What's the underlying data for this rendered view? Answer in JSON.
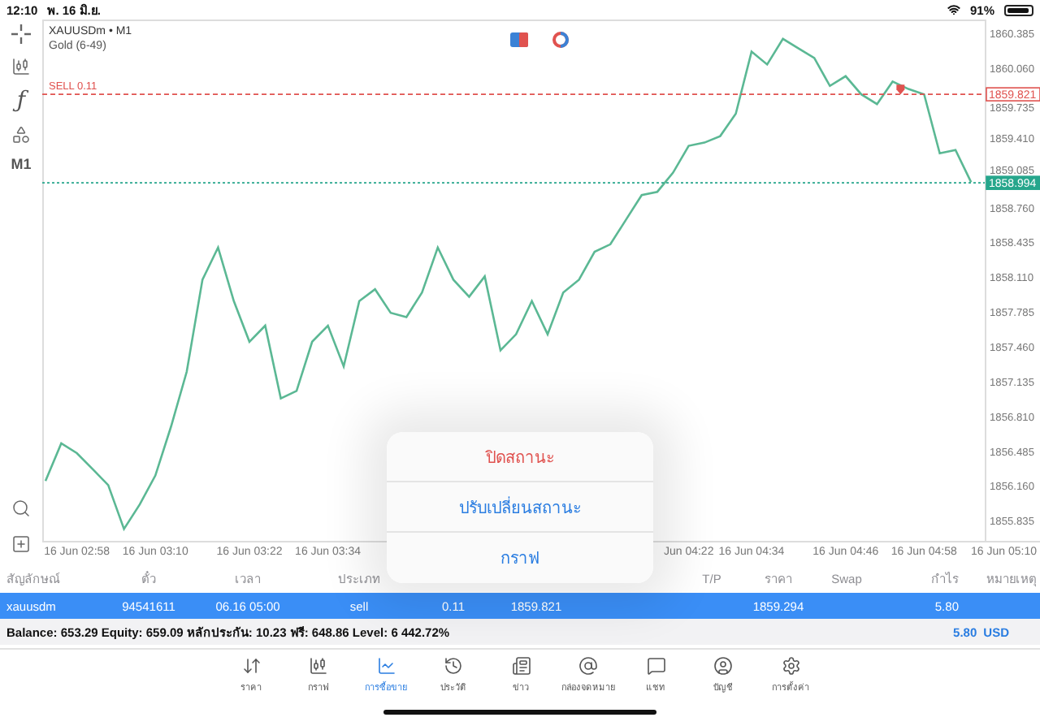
{
  "status_bar": {
    "time": "12:10",
    "date": "พ. 16 มิ.ย.",
    "battery": "91%"
  },
  "chart": {
    "symbol": "XAUUSDm • M1",
    "subtitle": "Gold (6-49)",
    "tools": [
      {
        "kind": "crosshair"
      },
      {
        "kind": "candles"
      },
      {
        "kind": "function",
        "label": "ƒ"
      },
      {
        "kind": "objects"
      },
      {
        "kind": "timeframe",
        "label": "M1"
      },
      {
        "kind": "zoom"
      },
      {
        "kind": "add"
      }
    ],
    "order_label": "SELL 0.11",
    "price_tags": [
      {
        "filled": false
      },
      {
        "filled": true
      }
    ],
    "chart_data": {
      "type": "line",
      "ylim": [
        1855.65,
        1860.52
      ],
      "categories": [
        null,
        null,
        "16 Jun 02:58",
        null,
        null,
        null,
        null,
        "16 Jun 03:10",
        null,
        null,
        null,
        null,
        null,
        "16 Jun 03:22",
        null,
        null,
        null,
        null,
        "16 Jun 03:34",
        null,
        null,
        null,
        null,
        null,
        null,
        null,
        null,
        null,
        null,
        null,
        null,
        null,
        null,
        null,
        null,
        null,
        null,
        null,
        null,
        null,
        null,
        "Jun 04:22",
        null,
        null,
        null,
        "16 Jun 04:34",
        null,
        null,
        null,
        null,
        null,
        "16 Jun 04:46",
        null,
        null,
        null,
        null,
        "16 Jun 04:58",
        null,
        null,
        null,
        null,
        "16 Jun 05:10"
      ],
      "yticks": [
        {
          "value": 1860.385,
          "label": "1860.385"
        },
        {
          "value": 1860.06,
          "label": "1860.060"
        },
        {
          "value": 1859.735,
          "label": "1859.735"
        },
        {
          "value": 1859.41,
          "label": "1859.410"
        },
        {
          "value": 1859.085,
          "label": "1859.085"
        },
        {
          "value": 1858.76,
          "label": "1858.760"
        },
        {
          "value": 1858.435,
          "label": "1858.435"
        },
        {
          "value": 1858.11,
          "label": "1858.110"
        },
        {
          "value": 1857.785,
          "label": "1857.785"
        },
        {
          "value": 1857.46,
          "label": "1857.460"
        },
        {
          "value": 1857.135,
          "label": "1857.135"
        },
        {
          "value": 1856.81,
          "label": "1856.810"
        },
        {
          "value": 1856.485,
          "label": "1856.485"
        },
        {
          "value": 1856.16,
          "label": "1856.160"
        },
        {
          "value": 1855.835,
          "label": "1855.835"
        }
      ],
      "series": [
        {
          "color": "#5bb894",
          "values": [
            1856.21,
            1856.56,
            1856.47,
            1856.32,
            1856.17,
            1855.76,
            1855.99,
            1856.26,
            1856.72,
            1857.23,
            1858.09,
            1858.39,
            1857.89,
            1857.51,
            1857.66,
            1856.98,
            1857.05,
            1857.51,
            1857.66,
            1857.28,
            1857.89,
            1858.0,
            1857.78,
            1857.74,
            1857.97,
            1858.39,
            1858.09,
            1857.93,
            1858.12,
            1857.43,
            1857.58,
            1857.89,
            1857.58,
            1857.97,
            1858.09,
            1858.35,
            1858.42,
            1858.65,
            1858.88,
            1858.91,
            1859.09,
            1859.34,
            1859.37,
            1859.43,
            1859.64,
            1860.22,
            1860.1,
            1860.34,
            1860.25,
            1860.16,
            1859.9,
            1859.99,
            1859.82,
            1859.73,
            1859.94,
            1859.87,
            1859.82,
            1859.27,
            1859.3,
            1859.0,
            null,
            null
          ]
        }
      ],
      "ref_lines": [
        {
          "axis": "y",
          "value": 1859.821,
          "label": "1859.821",
          "color": "#e0524f"
        },
        {
          "axis": "y",
          "value": 1858.994,
          "label": "1858.994",
          "color": "#26a68c"
        }
      ]
    }
  },
  "positions": {
    "columns": [
      "สัญลักษณ์",
      "ตั๋ว",
      "เวลา",
      "ประเภท",
      null,
      null,
      null,
      "T/P",
      "ราคา",
      "Swap",
      "กำไร",
      "หมายเหตุ"
    ],
    "rows": [
      {
        "selected": true,
        "cells": [
          "xauusdm",
          "94541611",
          "06.16 05:00",
          "sell",
          "0.11",
          "1859.821",
          null,
          null,
          "1859.294",
          null,
          "5.80",
          null
        ]
      }
    ]
  },
  "summary": {
    "text": "Balance: 653.29 Equity: 659.09 หลักประกัน: 10.23 ฟรี: 648.86 Level: 6 442.72%",
    "profit": "5.80",
    "currency": "USD"
  },
  "action_menu": {
    "items": [
      {
        "label": "ปิดสถานะ",
        "kind": "destructive"
      },
      {
        "label": "ปรับเปลี่ยนสถานะ",
        "kind": "action"
      },
      {
        "label": "กราฟ",
        "kind": "action"
      }
    ]
  },
  "tabs": [
    {
      "label": "ราคา",
      "selected": false
    },
    {
      "label": "กราฟ",
      "selected": false
    },
    {
      "label": "การซื้อขาย",
      "selected": true
    },
    {
      "label": "ประวัติ",
      "selected": false
    },
    {
      "label": "ข่าว",
      "selected": false
    },
    {
      "label": "กล่องจดหมาย",
      "selected": false
    },
    {
      "label": "แชท",
      "selected": false
    },
    {
      "label": "บัญชี",
      "selected": false
    },
    {
      "label": "การตั้งค่า",
      "selected": false
    }
  ]
}
